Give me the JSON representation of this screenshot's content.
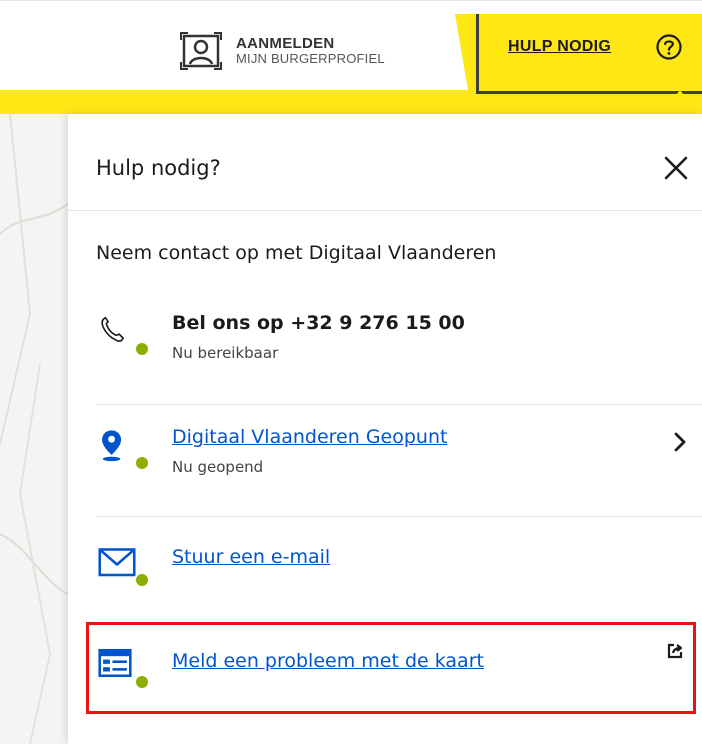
{
  "header": {
    "login_title": "AANMELDEN",
    "login_subtitle": "MIJN BURGERPROFIEL",
    "help_label": "HULP NODIG"
  },
  "panel": {
    "title": "Hulp nodig?",
    "section_title": "Neem contact op met Digitaal Vlaanderen",
    "items": [
      {
        "label": "Bel ons op +32 9 276 15 00",
        "status": "Nu bereikbaar",
        "icon": "phone-icon"
      },
      {
        "label": "Digitaal Vlaanderen Geopunt",
        "status": "Nu geopend",
        "icon": "location-pin-icon"
      },
      {
        "label": "Stuur een e-mail",
        "icon": "mail-icon"
      },
      {
        "label": "Meld een probleem met de kaart",
        "icon": "form-icon"
      }
    ]
  },
  "colors": {
    "brand_yellow": "#ffe615",
    "link_blue": "#0055cc",
    "status_green": "#8bae00",
    "highlight_red": "#ee1111"
  }
}
